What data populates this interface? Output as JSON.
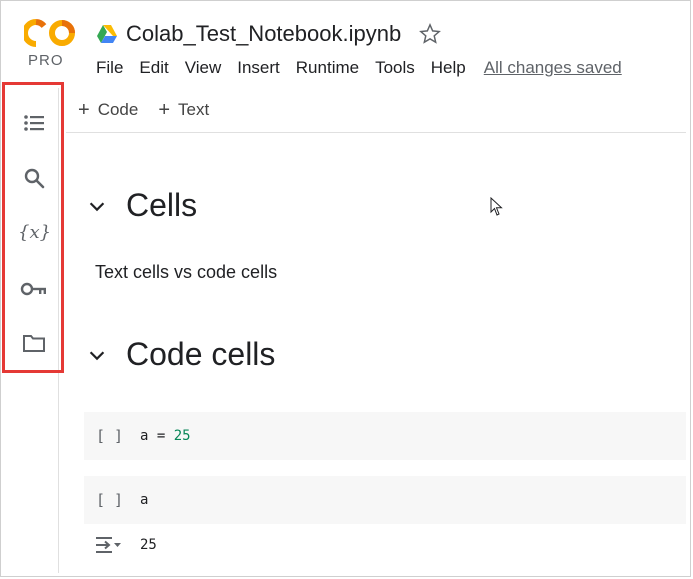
{
  "brand": {
    "logo_text": "PRO"
  },
  "header": {
    "title": "Colab_Test_Notebook.ipynb"
  },
  "menu": {
    "items": [
      "File",
      "Edit",
      "View",
      "Insert",
      "Runtime",
      "Tools",
      "Help"
    ],
    "saved_status": "All changes saved"
  },
  "toolbar": {
    "add_code_label": "Code",
    "add_text_label": "Text",
    "plus_glyph": "+"
  },
  "sidebar": {
    "icons": [
      "table-of-contents-icon",
      "search-icon",
      "variables-icon",
      "secrets-key-icon",
      "files-folder-icon"
    ]
  },
  "notebook": {
    "sections": [
      {
        "heading": "Cells"
      },
      {
        "heading": "Code cells"
      }
    ],
    "text_cell": "Text cells vs code cells",
    "code_cells": [
      {
        "run_bracket": "[ ]",
        "code_var": "a",
        "code_op": " = ",
        "code_num": "25"
      },
      {
        "run_bracket": "[ ]",
        "code_var": "a"
      }
    ],
    "output": "25"
  },
  "colors": {
    "highlight_border": "#e53935",
    "logo_orange": "#f9ab00",
    "logo_dark_orange": "#e8710a",
    "number_literal": "#098658"
  }
}
